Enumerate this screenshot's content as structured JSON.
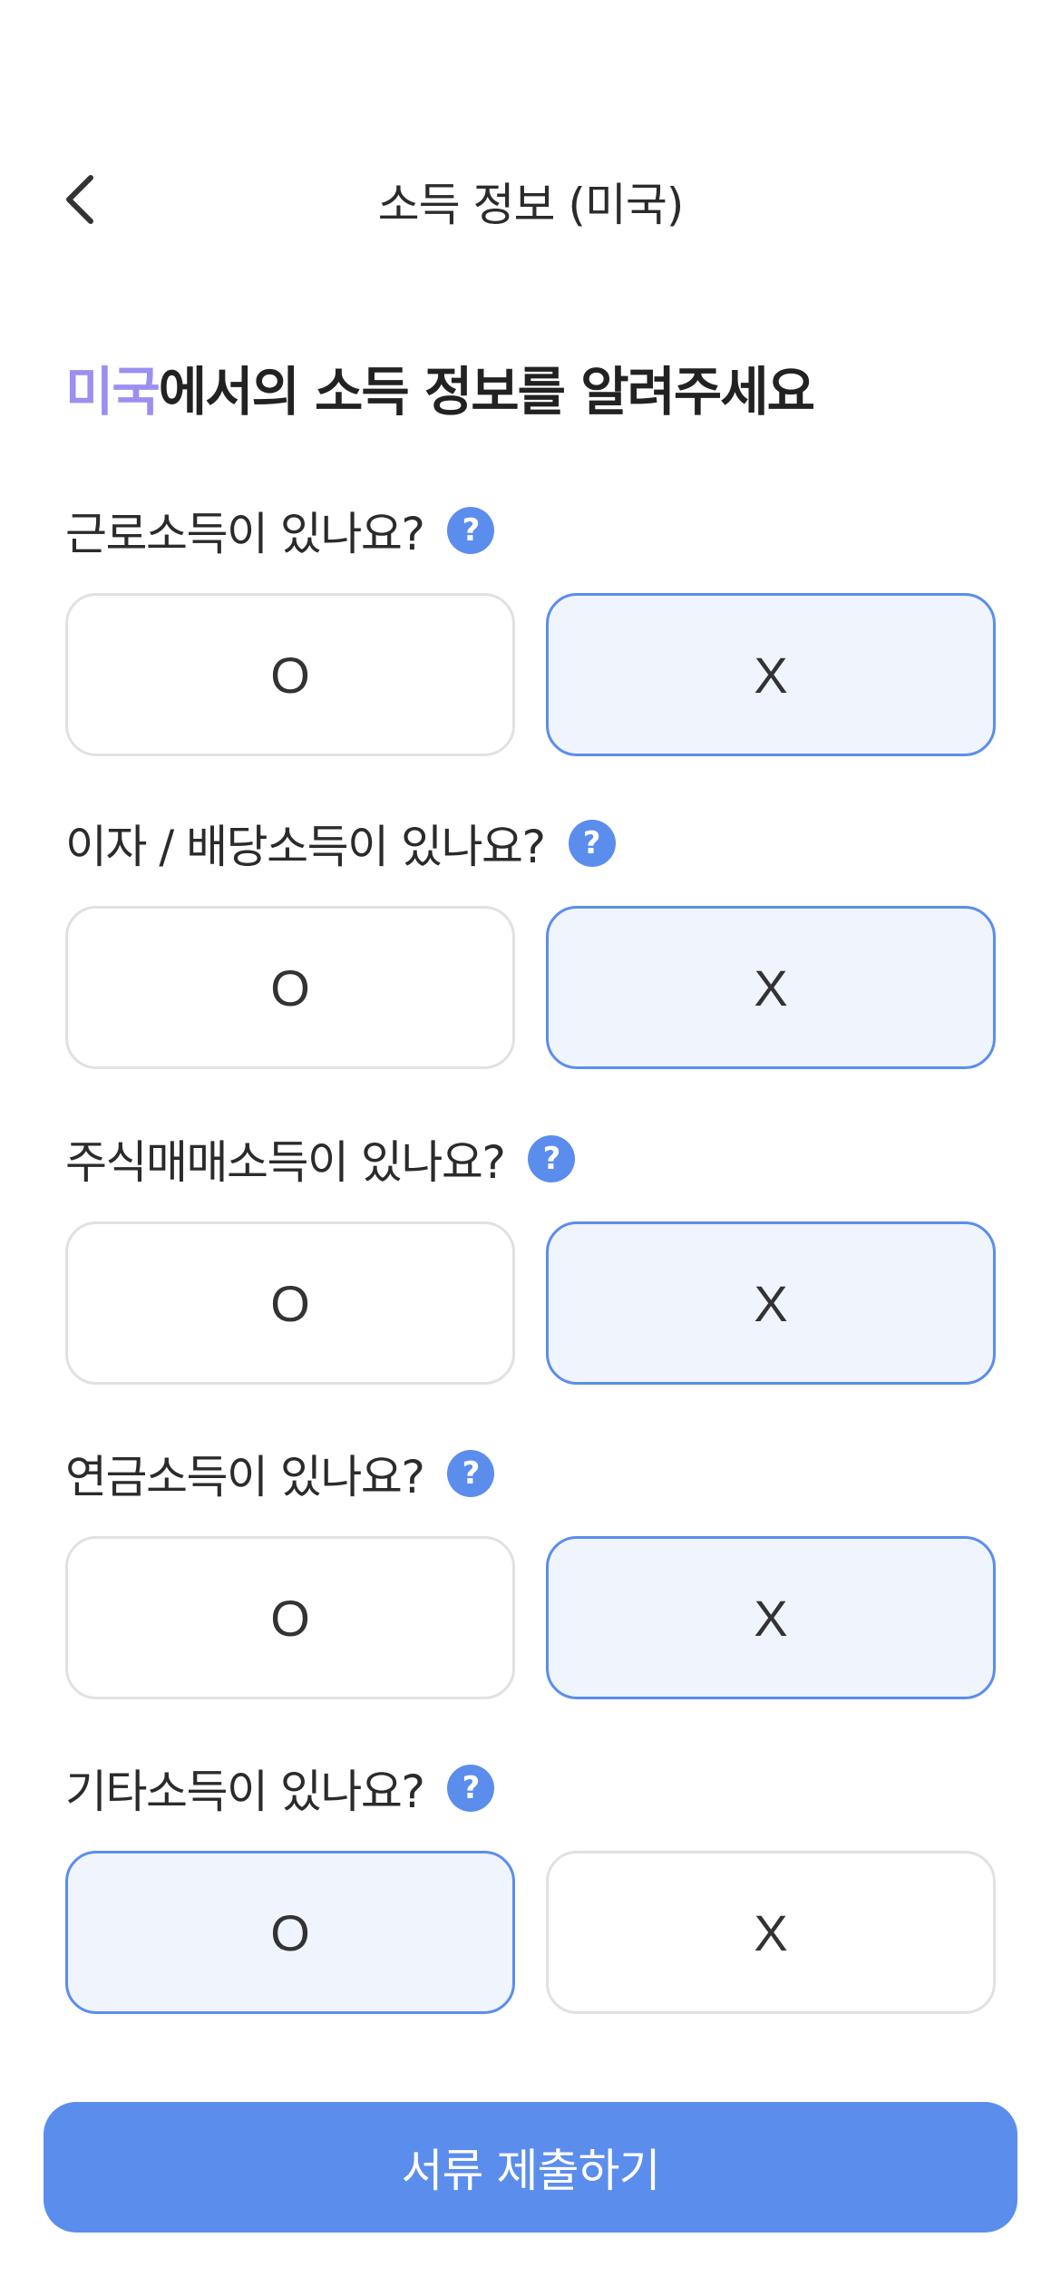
{
  "header": {
    "title": "소득 정보 (미국)",
    "back_icon": "chevron-left-icon"
  },
  "headline": {
    "accent": "미국",
    "rest": "에서의 소득 정보를 알려주세요"
  },
  "help_icon_glyph": "?",
  "questions": [
    {
      "label": "근로소득이 있나요?",
      "yes": "O",
      "no": "X",
      "selected": "X"
    },
    {
      "label": "이자 / 배당소득이 있나요?",
      "yes": "O",
      "no": "X",
      "selected": "X"
    },
    {
      "label": "주식매매소득이 있나요?",
      "yes": "O",
      "no": "X",
      "selected": "X"
    },
    {
      "label": "연금소득이 있나요?",
      "yes": "O",
      "no": "X",
      "selected": "X"
    },
    {
      "label": "기타소득이 있나요?",
      "yes": "O",
      "no": "X",
      "selected": "O"
    }
  ],
  "submit_label": "서류 제출하기",
  "colors": {
    "accent": "#9b8ff0",
    "primary": "#5b8ded",
    "selected_bg": "#f0f5fd",
    "border": "#e1e1e1"
  }
}
